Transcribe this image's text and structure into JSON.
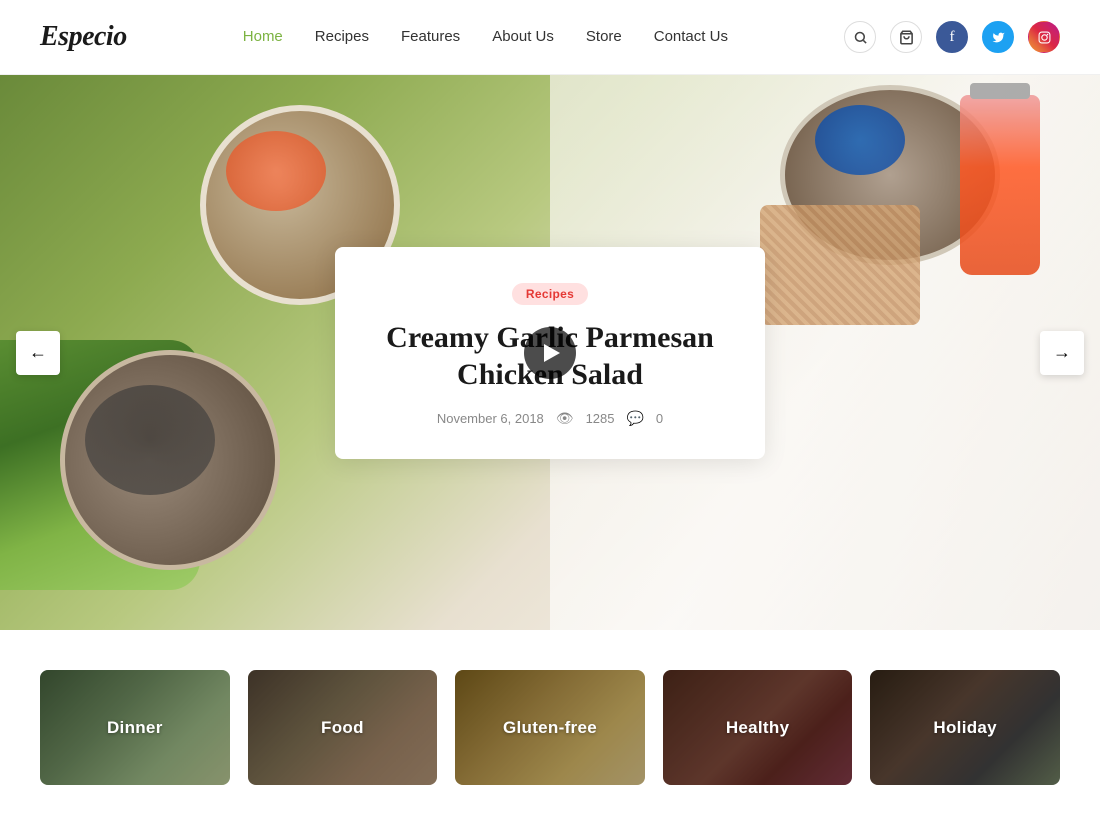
{
  "brand": {
    "name": "Especio"
  },
  "nav": {
    "links": [
      {
        "label": "Home",
        "active": true
      },
      {
        "label": "Recipes",
        "active": false
      },
      {
        "label": "Features",
        "active": false
      },
      {
        "label": "About Us",
        "active": false
      },
      {
        "label": "Store",
        "active": false
      },
      {
        "label": "Contact Us",
        "active": false
      }
    ],
    "search_label": "search",
    "cart_label": "cart"
  },
  "hero": {
    "badge": "Recipes",
    "title": "Creamy Garlic Parmesan Chicken Salad",
    "date": "November 6, 2018",
    "views": "1285",
    "comments": "0",
    "prev_label": "←",
    "next_label": "→"
  },
  "categories": {
    "items": [
      {
        "label": "Dinner",
        "key": "dinner"
      },
      {
        "label": "Food",
        "key": "food"
      },
      {
        "label": "Gluten-free",
        "key": "glutenfree"
      },
      {
        "label": "Healthy",
        "key": "healthy"
      },
      {
        "label": "Holiday",
        "key": "holiday"
      }
    ]
  },
  "social": {
    "facebook": "f",
    "twitter": "t",
    "instagram": "ig"
  }
}
